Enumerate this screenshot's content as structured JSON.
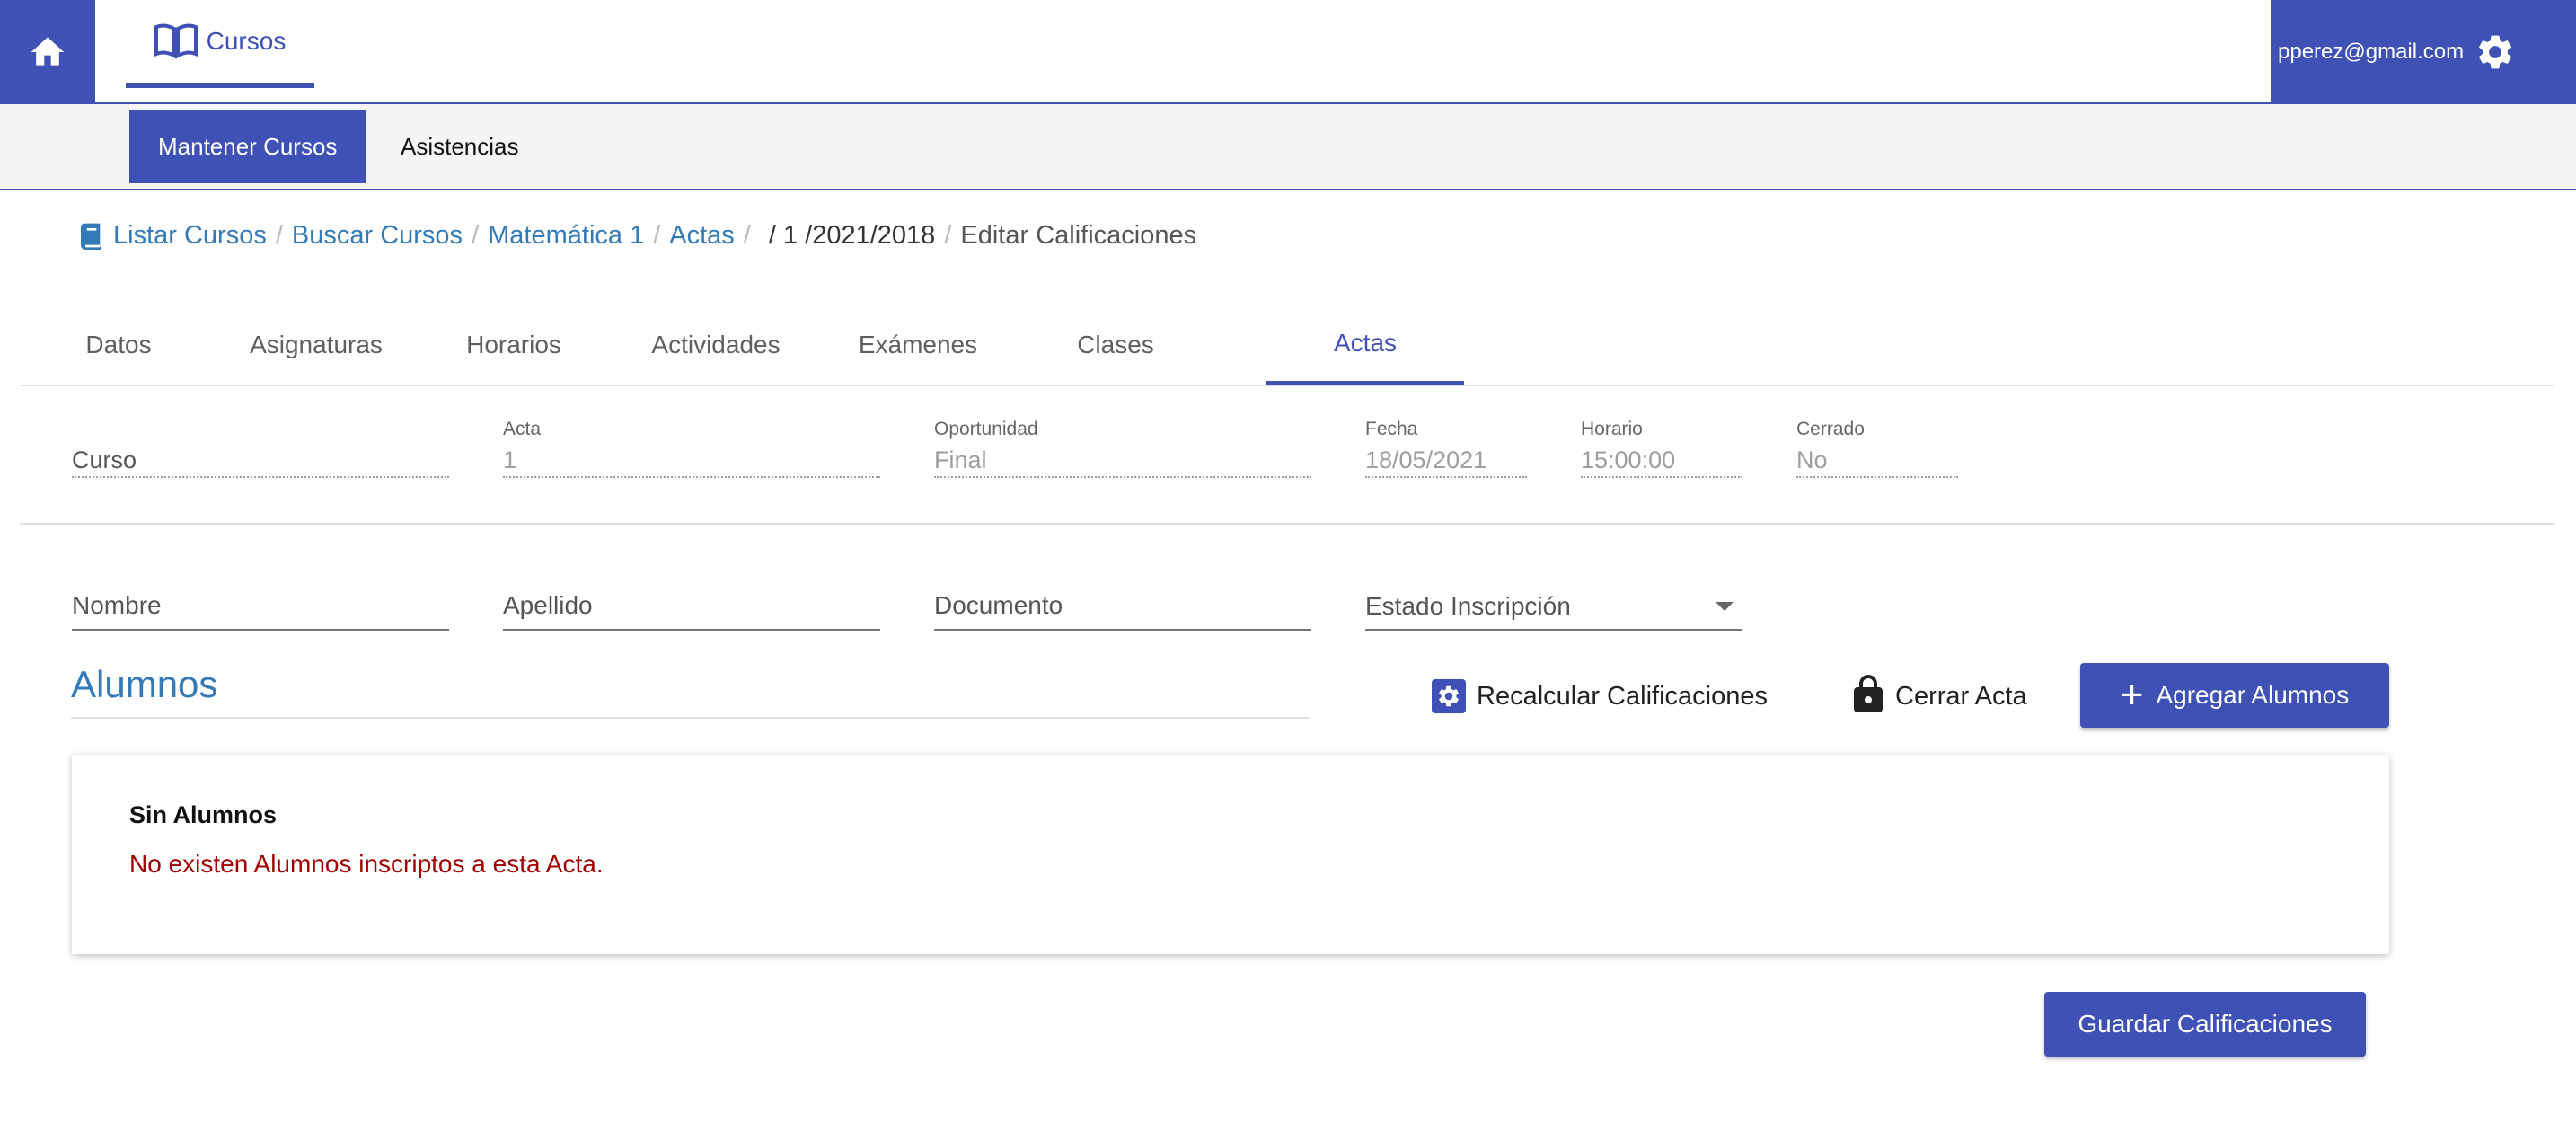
{
  "header": {
    "home_icon": "home-icon",
    "main_tab_label": "Cursos",
    "main_tab_icon": "book-open-icon",
    "user_email": "pperez@gmail.com",
    "settings_icon": "gear-icon",
    "accent_color": "#3f51b5"
  },
  "subnav": {
    "items": [
      {
        "label": "Mantener Cursos",
        "active": true
      },
      {
        "label": "Asistencias",
        "active": false
      }
    ]
  },
  "breadcrumb": {
    "icon": "book-icon",
    "items": [
      {
        "label": "Listar Cursos",
        "link": true
      },
      {
        "label": "Buscar Cursos",
        "link": true
      },
      {
        "label": "Matemática 1",
        "link": true
      },
      {
        "label": "Actas",
        "link": true
      },
      {
        "label": "/ 1 /2021/2018",
        "link": false
      },
      {
        "label": "Editar Calificaciones",
        "link": false
      }
    ]
  },
  "tabs": [
    {
      "label": "Datos",
      "active": false
    },
    {
      "label": "Asignaturas",
      "active": false
    },
    {
      "label": "Horarios",
      "active": false
    },
    {
      "label": "Actividades",
      "active": false
    },
    {
      "label": "Exámenes",
      "active": false
    },
    {
      "label": "Clases",
      "active": false
    },
    {
      "label": "Actas",
      "active": true
    }
  ],
  "acta": {
    "curso": {
      "label": "",
      "value": "Curso"
    },
    "acta": {
      "label": "Acta",
      "value": "1"
    },
    "oportunidad": {
      "label": "Oportunidad",
      "value": "Final"
    },
    "fecha": {
      "label": "Fecha",
      "value": "18/05/2021"
    },
    "horario": {
      "label": "Horario",
      "value": "15:00:00"
    },
    "cerrado": {
      "label": "Cerrado",
      "value": "No"
    }
  },
  "filters": {
    "nombre_placeholder": "Nombre",
    "apellido_placeholder": "Apellido",
    "documento_placeholder": "Documento",
    "estado_label": "Estado Inscripción"
  },
  "alumnos": {
    "title": "Alumnos",
    "recalcular_label": "Recalcular Calificaciones",
    "cerrar_label": "Cerrar Acta",
    "agregar_label": "Agregar Alumnos",
    "empty_title": "Sin Alumnos",
    "empty_message": "No existen Alumnos inscriptos a esta Acta.",
    "error_color": "#a00000"
  },
  "footer": {
    "guardar_label": "Guardar Calificaciones"
  }
}
